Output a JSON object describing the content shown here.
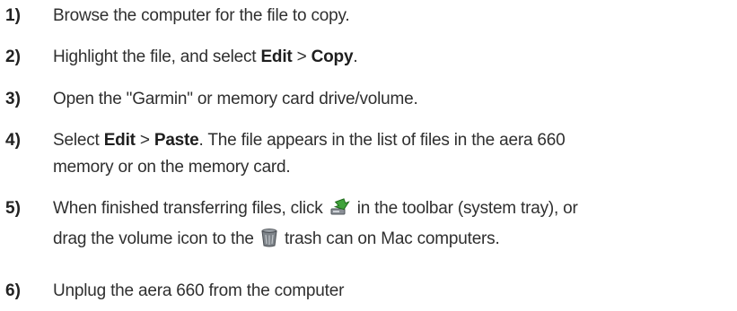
{
  "steps": [
    {
      "num": "1)",
      "text": "Browse the computer for the file to copy."
    },
    {
      "num": "2)",
      "pre": "Highlight the file, and select ",
      "b1": "Edit",
      "mid": " > ",
      "b2": "Copy",
      "post": "."
    },
    {
      "num": "3)",
      "text": "Open the \"Garmin\" or memory card drive/volume."
    },
    {
      "num": "4)",
      "pre": "Select ",
      "b1": "Edit",
      "mid": " > ",
      "b2": "Paste",
      "post1": ".  The file appears in the list of files in the aera 660",
      "line2": "memory or on the memory card."
    },
    {
      "num": "5)",
      "pre": "When finished transferring files, click ",
      "post": " in the toolbar (system tray), or",
      "line2_pre": "drag the volume icon to the ",
      "line2_post": " trash can on Mac computers.",
      "icon1": "safely-remove-hardware-icon",
      "icon2": "trash-can-icon"
    },
    {
      "num": "6)",
      "text": "Unplug the aera 660 from the computer"
    }
  ]
}
